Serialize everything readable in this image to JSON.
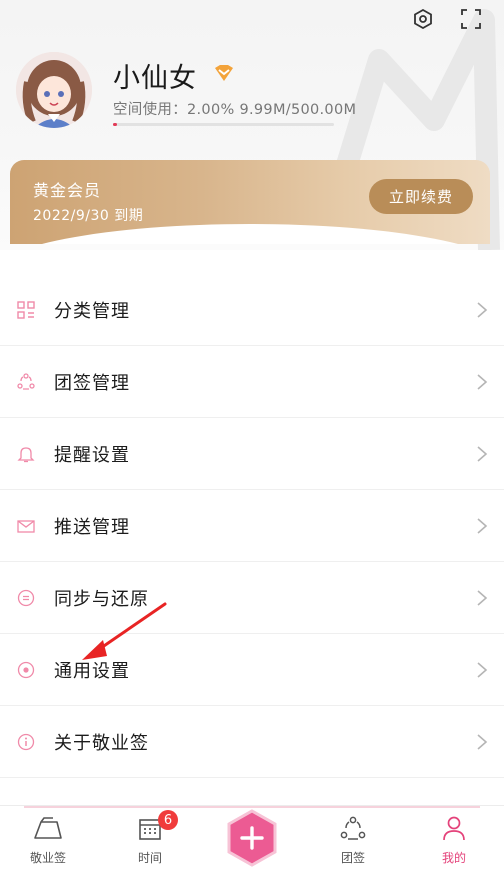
{
  "profile": {
    "username": "小仙女",
    "storage_label": "空间使用：2.00%  9.99M/500.00M",
    "storage_used_fraction": 0.02
  },
  "membership": {
    "title": "黄金会员",
    "expiry": "2022/9/30 到期",
    "renew_label": "立即续费"
  },
  "menu": {
    "items": [
      {
        "label": "分类管理",
        "icon": "category-icon"
      },
      {
        "label": "团签管理",
        "icon": "group-icon"
      },
      {
        "label": "提醒设置",
        "icon": "bell-icon"
      },
      {
        "label": "推送管理",
        "icon": "mail-icon"
      },
      {
        "label": "同步与还原",
        "icon": "sync-icon"
      },
      {
        "label": "通用设置",
        "icon": "settings-dot-icon"
      },
      {
        "label": "关于敬业签",
        "icon": "info-icon"
      }
    ]
  },
  "tabbar": {
    "tabs": [
      {
        "label": "敬业签",
        "icon": "note-icon"
      },
      {
        "label": "时间",
        "icon": "calendar-icon",
        "badge": "6"
      },
      {
        "label": "",
        "icon": "add-icon"
      },
      {
        "label": "团签",
        "icon": "team-icon"
      },
      {
        "label": "我的",
        "icon": "user-icon",
        "active": true
      }
    ]
  },
  "colors": {
    "accent": "#e4427a",
    "gold": "#b98d58",
    "annotation": "#e82424"
  }
}
